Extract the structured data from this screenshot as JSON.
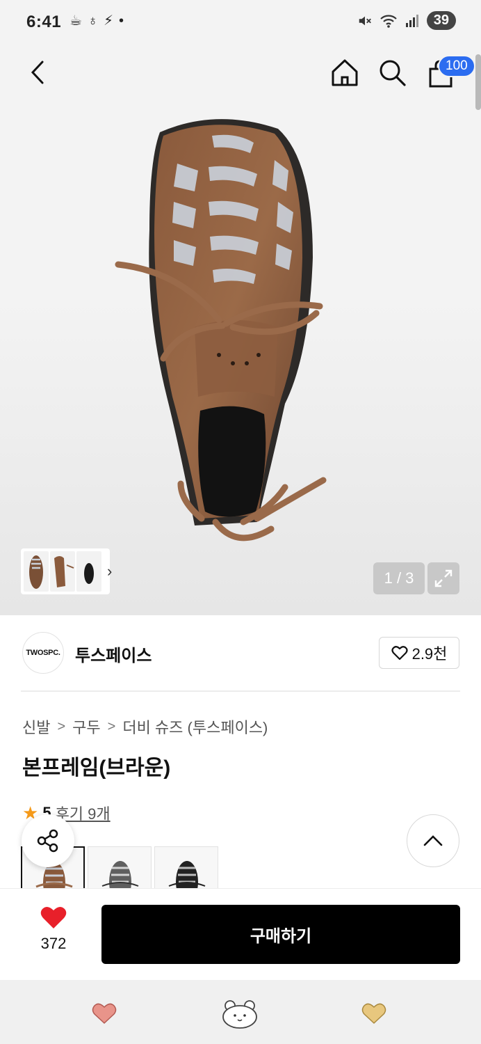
{
  "status_bar": {
    "time": "6:41",
    "battery": "39"
  },
  "header": {
    "cart_count": "100"
  },
  "gallery": {
    "page_counter": "1 / 3"
  },
  "brand": {
    "logo_text": "TWOSPC.",
    "name": "투스페이스",
    "likes": "2.9천"
  },
  "breadcrumb": {
    "items": [
      "신발",
      "구두",
      "더비 슈즈 (투스페이스)"
    ],
    "separator": ">"
  },
  "product": {
    "title": "본프레임(브라운)",
    "rating": "5",
    "review_label": "후기 9개"
  },
  "buy_bar": {
    "like_count": "372",
    "buy_label": "구매하기"
  },
  "icons": {
    "back": "back-arrow-icon",
    "home": "home-icon",
    "search": "search-icon",
    "cart": "shopping-bag-icon",
    "expand": "expand-icon",
    "heart": "heart-icon",
    "share": "share-icon",
    "scroll_top": "chevron-up-icon"
  },
  "colors": {
    "accent_badge": "#2b6cf0",
    "heart": "#e8202a",
    "star": "#f59a1a",
    "buy_button": "#000000"
  }
}
